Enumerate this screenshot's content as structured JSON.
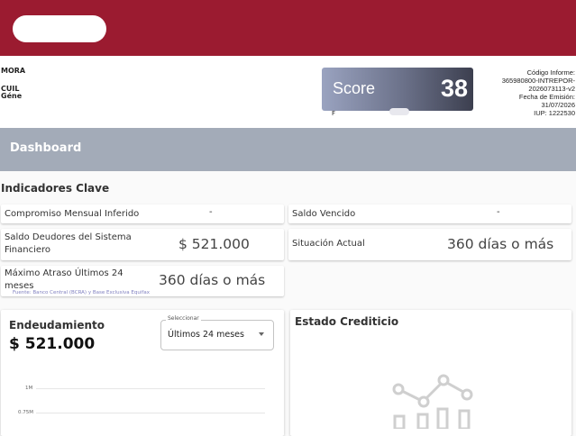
{
  "header": {
    "brand_color": "#9b1b30",
    "person": {
      "name": "MORA",
      "cuil_label": "CUIL",
      "genero_label": "Géne"
    },
    "score": {
      "label": "Score",
      "value": "38"
    },
    "score_subtext": "F",
    "report": {
      "codigo_label": "Código Informe:",
      "codigo_line1": "365980800-INTREPOR-",
      "codigo_line2": "2026073113-v2",
      "fecha_label": "Fecha de Emisión:",
      "fecha": "31/07/2026",
      "iup": "IUP: 1222530"
    }
  },
  "dashboard": {
    "title": "Dashboard",
    "bar_color": "#a3abb8"
  },
  "indicadores": {
    "title": "Indicadores Clave",
    "compromiso": {
      "label": "Compromiso Mensual Inferido",
      "value": "-"
    },
    "saldo_vencido": {
      "label": "Saldo Vencido",
      "value": "-"
    },
    "saldo_deudores": {
      "label": "Saldo Deudores del Sistema Financiero",
      "value": "$ 521.000"
    },
    "situacion_actual": {
      "label": "Situación Actual",
      "value": "360 días o más"
    },
    "maximo_atraso": {
      "label": "Máximo Atraso Últimos 24 meses",
      "value": "360 días o más"
    },
    "source": "Fuente: Banco Central (BCRA) y Base Exclusiva Equifax"
  },
  "endeudamiento": {
    "title": "Endeudamiento",
    "value": "$ 521.000",
    "select": {
      "label": "Seleccionar",
      "value": "Últimos 24 meses"
    },
    "y_ticks": [
      "1M",
      "0.75M"
    ],
    "bar_fraction": 0.52
  },
  "estado": {
    "title": "Estado Crediticio",
    "icon": "chart-placeholder-icon"
  }
}
